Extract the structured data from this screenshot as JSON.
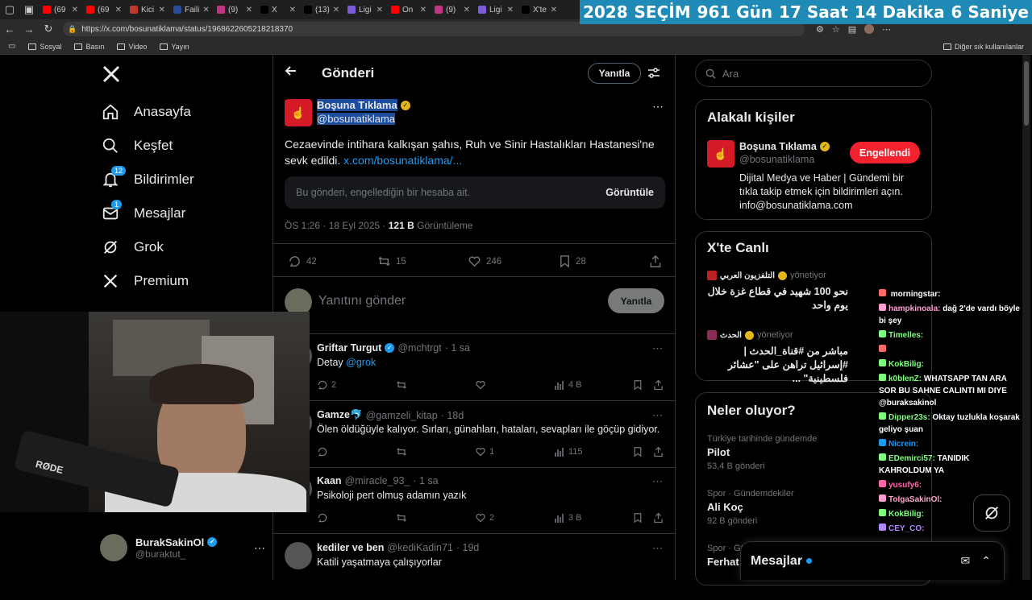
{
  "browser": {
    "tabs": [
      {
        "label": "(69",
        "color": "#ff0000"
      },
      {
        "label": "(69",
        "color": "#ff0000"
      },
      {
        "label": "Kici",
        "color": "#c0392b"
      },
      {
        "label": "Faili",
        "color": "#2a4a9a"
      },
      {
        "label": "(9)",
        "color": "#c13584"
      },
      {
        "label": "X",
        "color": "#000000"
      },
      {
        "label": "(13)",
        "color": "#000000"
      },
      {
        "label": "Ligi",
        "color": "#7b5cd6"
      },
      {
        "label": "On",
        "color": "#ff0000"
      },
      {
        "label": "(9)",
        "color": "#c13584"
      },
      {
        "label": "Ligi",
        "color": "#7b5cd6"
      },
      {
        "label": "X'te",
        "color": "#000000"
      }
    ],
    "url": "https://x.com/bosunatiklama/status/1968622605218218370",
    "bookmarks": [
      "Sosyal",
      "Basın",
      "Video",
      "Yayın"
    ],
    "other_bookmarks": "Diğer sık kullanılanlar"
  },
  "countdown": {
    "year": "2028",
    "label": "SEÇİM",
    "days": "961 Gün",
    "hours": "17 Saat",
    "minutes": "14 Dakika",
    "seconds": "6 Saniye"
  },
  "nav": {
    "items": [
      {
        "label": "Anasayfa",
        "icon": "home-icon"
      },
      {
        "label": "Keşfet",
        "icon": "search-icon"
      },
      {
        "label": "Bildirimler",
        "icon": "bell-icon",
        "badge": "12"
      },
      {
        "label": "Mesajlar",
        "icon": "mail-icon",
        "badge": "1"
      },
      {
        "label": "Grok",
        "icon": "grok-icon"
      },
      {
        "label": "Premium",
        "icon": "x-logo-icon"
      }
    ],
    "account": {
      "name": "BurakSakinOl",
      "handle": "@buraktut_"
    }
  },
  "main": {
    "header_title": "Gönderi",
    "reply_button": "Yanıtla",
    "post": {
      "author_name": "Boşuna Tıklama",
      "author_handle": "@bosunatiklama",
      "text": "Cezaevinde intihara kalkışan şahıs, Ruh ve Sinir Hastalıkları Hastanesi'ne sevk edildi.",
      "link": "x.com/bosunatiklama/...",
      "blocked_notice": "Bu gönderi, engellediğin bir hesaba ait.",
      "view_button": "Görüntüle",
      "time": "ÖS 1:26 · 18 Eyl 2025 · ",
      "views": "121 B",
      "views_label": " Görüntüleme",
      "replies": "42",
      "reposts": "15",
      "likes": "246",
      "bookmarks": "28"
    },
    "compose_placeholder": "Yanıtını gönder",
    "compose_button": "Yanıtla",
    "replies": [
      {
        "name": "Griftar Turgut",
        "handle": "@mchtrgt",
        "time": "· 1 sa",
        "text": "Detay ",
        "mention": "@grok",
        "reply_count": "2",
        "like_count": "",
        "view_count": "4 B"
      },
      {
        "name": "Gamze🐬",
        "handle": "@gamzeli_kitap",
        "time": "· 18d",
        "text": "Ölen öldüğüyle kalıyor. Sırları, günahları, hataları, sevapları ile göçüp gidiyor.",
        "mention": "",
        "reply_count": "",
        "like_count": "1",
        "view_count": "115"
      },
      {
        "name": "Kaan",
        "handle": "@miracle_93_",
        "time": "· 1 sa",
        "text": "Psikoloji pert olmuş adamın yazık",
        "mention": "",
        "reply_count": "",
        "like_count": "2",
        "view_count": "3 B"
      },
      {
        "name": "kediler ve ben",
        "handle": "@kediKadin71",
        "time": "· 19d",
        "text": "Katili yaşatmaya çalışıyorlar",
        "mention": "",
        "reply_count": "",
        "like_count": "",
        "view_count": ""
      }
    ]
  },
  "right": {
    "search_placeholder": "Ara",
    "related_title": "Alakalı kişiler",
    "related_person": {
      "name": "Boşuna Tıklama",
      "handle": "@bosunatiklama",
      "button": "Engellendi",
      "bio": "Dijital Medya ve Haber | Gündemi bir tıkla takip etmek için bildirimleri açın. info@bosunatiklama.com"
    },
    "live_title": "X'te Canlı",
    "live_items": [
      {
        "host": "التلفزيون العربي",
        "status": "yönetiyor",
        "text": "نحو 100 شهيد في قطاع غزة خلال يوم واحد"
      },
      {
        "host": "الحدث",
        "status": "yönetiyor",
        "text": "مباشر من #قناة_الحدث | #إسرائيل تراهن على \"عشائر فلسطينية\" ..."
      }
    ],
    "trends_title": "Neler oluyor?",
    "trends": [
      {
        "context": "Türkiye tarihinde gündemde",
        "name": "Pilot",
        "count": "53,4 B gönderi"
      },
      {
        "context": "Spor · Gündemdekiler",
        "name": "Ali Koç",
        "count": "92 B gönderi"
      },
      {
        "context": "Spor · Gü",
        "name": "Ferhat",
        "count": ""
      }
    ],
    "messages_drawer": "Mesajlar"
  },
  "chat": [
    {
      "user": "",
      "text": "morningstar:",
      "color": "#ff6b6b"
    },
    {
      "user": "hampkinoala:",
      "text": "dağ 2'de vardı böyle bi şey",
      "color": "#ff9ecf"
    },
    {
      "user": "Timelles:",
      "text": "",
      "color": "#7fff7f"
    },
    {
      "user": "",
      "text": "",
      "color": "#ff6b6b"
    },
    {
      "user": "KokBilig:",
      "text": "",
      "color": "#7fff7f"
    },
    {
      "user": "k0blenZ:",
      "text": "WHATSAPP TAN ARA SOR BU SAHNE CALINTI MI DIYE @buraksakinol",
      "color": "#7fff7f"
    },
    {
      "user": "Dipper23s:",
      "text": "Oktay tuzlukla koşarak geliyo şuan",
      "color": "#7fff7f"
    },
    {
      "user": "Nicrein:",
      "text": "",
      "color": "#1d9bf0"
    },
    {
      "user": "EDemirci57:",
      "text": "TANIDIK KAHROLDUM YA",
      "color": "#7fff7f"
    },
    {
      "user": "yusufy6:",
      "text": "",
      "color": "#ff66aa"
    },
    {
      "user": "TolgaSakinOl:",
      "text": "",
      "color": "#ff9ecf"
    },
    {
      "user": "KokBilig:",
      "text": "",
      "color": "#7fff7f"
    },
    {
      "user": "CEY_CO:",
      "text": "",
      "color": "#b388ff"
    }
  ],
  "webcam": {
    "mic_brand": "RØDE"
  }
}
